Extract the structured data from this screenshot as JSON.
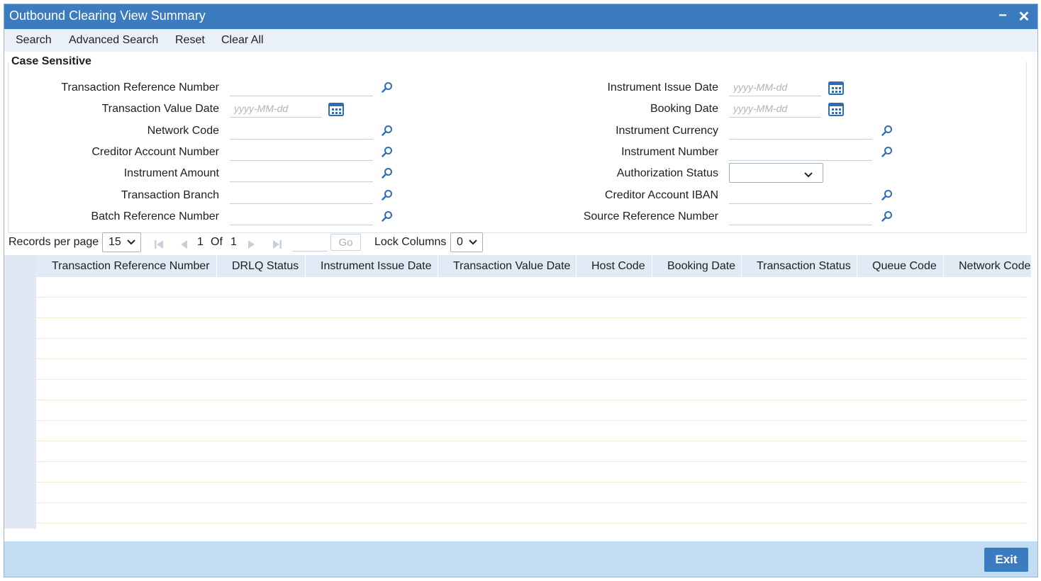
{
  "window": {
    "title": "Outbound Clearing View Summary",
    "minimize_glyph": "−",
    "close_glyph": "✕"
  },
  "menu": {
    "items": [
      "Search",
      "Advanced Search",
      "Reset",
      "Clear All"
    ]
  },
  "criteria": {
    "section_title": "Case Sensitive",
    "left": [
      {
        "label": "Transaction Reference Number",
        "kind": "lov",
        "value": ""
      },
      {
        "label": "Transaction Value Date",
        "kind": "date",
        "placeholder": "yyyy-MM-dd"
      },
      {
        "label": "Network Code",
        "kind": "lov",
        "value": ""
      },
      {
        "label": "Creditor Account Number",
        "kind": "lov",
        "value": ""
      },
      {
        "label": "Instrument Amount",
        "kind": "lov",
        "value": ""
      },
      {
        "label": "Transaction Branch",
        "kind": "lov",
        "value": ""
      },
      {
        "label": "Batch Reference Number",
        "kind": "lov",
        "value": ""
      }
    ],
    "right": [
      {
        "label": "Instrument Issue Date",
        "kind": "date",
        "placeholder": "yyyy-MM-dd"
      },
      {
        "label": "Booking Date",
        "kind": "date",
        "placeholder": "yyyy-MM-dd"
      },
      {
        "label": "Instrument Currency",
        "kind": "lov",
        "value": ""
      },
      {
        "label": "Instrument Number",
        "kind": "lov",
        "value": ""
      },
      {
        "label": "Authorization Status",
        "kind": "select",
        "value": ""
      },
      {
        "label": "Creditor Account IBAN",
        "kind": "lov",
        "value": ""
      },
      {
        "label": "Source Reference Number",
        "kind": "lov",
        "value": ""
      }
    ]
  },
  "pager": {
    "records_label": "Records per page",
    "records_value": "15",
    "page": "1",
    "of_label": "Of",
    "total_pages": "1",
    "go_label": "Go",
    "lock_label": "Lock Columns",
    "lock_value": "0"
  },
  "grid": {
    "columns": [
      "Transaction Reference Number",
      "DRLQ Status",
      "Instrument Issue Date",
      "Transaction Value Date",
      "Host Code",
      "Booking Date",
      "Transaction Status",
      "Queue Code",
      "Network Code"
    ],
    "empty_rows": 12
  },
  "footer": {
    "exit_label": "Exit"
  },
  "colors": {
    "title_bar": "#3b7bc0",
    "menu_bar": "#eaf0f7",
    "grid_header": "#e1ebf6",
    "footer": "#c2dcf2",
    "exit_button": "#3b7bc0",
    "icon_blue": "#2e6db4"
  },
  "icons": {
    "lookup": "search-icon",
    "date": "calendar-icon",
    "first": "first-page-icon",
    "prev": "previous-page-icon",
    "next": "next-page-icon",
    "last": "last-page-icon",
    "dropdown": "chevron-down-icon"
  }
}
